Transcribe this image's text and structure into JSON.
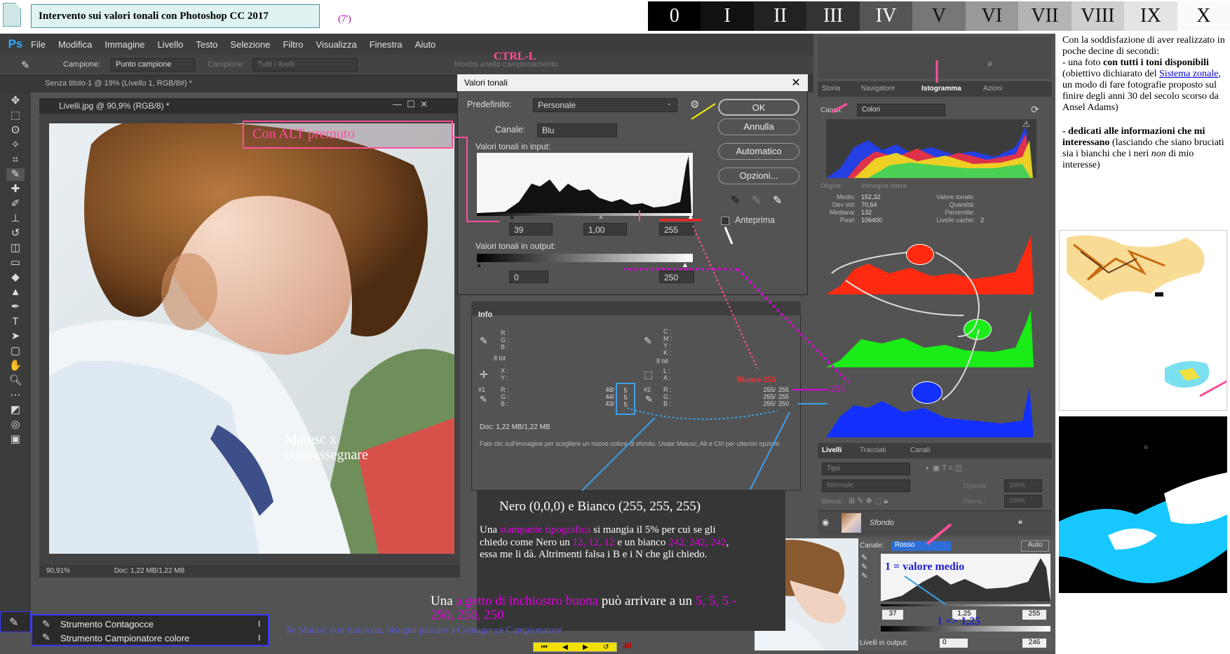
{
  "slide": {
    "title": "Intervento sui valori tonali con Photoshop CC 2017",
    "time": "(7')",
    "roman_nav": [
      "0",
      "I",
      "II",
      "III",
      "IV",
      "V",
      "VI",
      "VII",
      "VIII",
      "IX",
      "X"
    ],
    "page_number": "40"
  },
  "ps": {
    "logo": "Ps",
    "menu": [
      "File",
      "Modifica",
      "Immagine",
      "Livello",
      "Testo",
      "Selezione",
      "Filtro",
      "Visualizza",
      "Finestra",
      "Aiuto"
    ],
    "options": {
      "sample_label": "Campione:",
      "sample_value": "Punto campione",
      "size_label": "Campione:",
      "size_value": "Tutti i livelli",
      "ring_label": "Mostra anello campionamento"
    },
    "tab_bg": "Senza titolo-1 @ 19% (Livello 1, RGB/8#) *",
    "doc_title": "Livelli.jpg @ 90,9% (RGB/8) *",
    "doc_status_zoom": "90,91%",
    "doc_status_size": "Doc: 1,22 MB/1,22 MB",
    "tool_popup": [
      "Strumento Contagocce",
      "Strumento Campionatore colore"
    ],
    "tool_popup_keys": [
      "I",
      "I"
    ]
  },
  "levels": {
    "window_title": "Valori tonali",
    "preset_label": "Predefinito:",
    "preset_value": "Personale",
    "channel_label": "Canale:",
    "channel_value": "Blu",
    "input_label": "Valori tonali in input:",
    "input_values": [
      "39",
      "1,00",
      "255"
    ],
    "output_label": "Valori tonali in output:",
    "output_values": [
      "0",
      "250"
    ],
    "buttons": [
      "OK",
      "Annulla",
      "Automatico",
      "Opzioni..."
    ],
    "preview_label": "Anteprima"
  },
  "info": {
    "tab": "Info",
    "rgb_letters": [
      "R :",
      "G :",
      "B :"
    ],
    "cmyk_letters": [
      "C :",
      "M :",
      "Y :",
      "K :"
    ],
    "bit_left": "8 bit",
    "bit_right": "8 bit",
    "xy": [
      "X :",
      "Y :"
    ],
    "lab": [
      "L :",
      "A :"
    ],
    "s1_label": "#1",
    "s1_vals": [
      "48/",
      "44/",
      "43/"
    ],
    "s1_after": [
      "5",
      "5",
      "5"
    ],
    "s2_label": "#2",
    "s2_vals": [
      "255/",
      "255/",
      "255/"
    ],
    "s2_after": [
      "255",
      "255",
      "250"
    ],
    "doc": "Doc: 1,22 MB/1,22 MB",
    "hint": "Fate clic sull'immagine per scegliere un nuovo colore di sfondo. Usate Maiusc, Alt e Ctrl per ulteriori opzioni."
  },
  "dock": {
    "hist_tabs": [
      "Storia",
      "Navigatore",
      "Istogramma",
      "Azioni"
    ],
    "canali_label": "Canali:",
    "canali_value": "Colori",
    "stats_left_labels": [
      "Medio:",
      "Dev std:",
      "Mediana:",
      "Pixel:"
    ],
    "stats_left_values": [
      "152,32",
      "70,64",
      "132",
      "106400"
    ],
    "stats_right_labels": [
      "Valore tonale:",
      "Quantità:",
      "Percentile:",
      "Livello cache:"
    ],
    "stats_right_values": [
      "",
      "",
      "",
      "2"
    ],
    "origin_label": "Origine:",
    "origin_value": "Immagine intera",
    "layers_tabs": [
      "Livelli",
      "Tracciati",
      "Canali"
    ],
    "filter_placeholder": "Tipo",
    "blend_mode": "Normale",
    "opacity_label": "Opacità:",
    "opacity_value": "100%",
    "lock_label": "Blocca:",
    "fill_label": "Riemp.:",
    "fill_value": "100%",
    "layer_name": "Sfondo"
  },
  "inset": {
    "channel_label": "Canale:",
    "channel_value": "Rosso",
    "auto": "Auto",
    "input_values": [
      "37",
      "1,25",
      "255"
    ],
    "output_label": "Livelli in output:",
    "output_values": [
      "0",
      "246"
    ]
  },
  "annotations": {
    "ctrl_l": "CTRL-L",
    "alt": "Con ALT premuto",
    "maiusc": "Maiusc x contrassegnare",
    "bianco": "Bianco 255",
    "arrow255": "255",
    "nero_bianco": "Nero (0,0,0) e Bianco (255, 255, 255)",
    "stampante_pre": "Una ",
    "stampante_hl": "stampante tipografica",
    "stampante_mid": " si mangia il 5% per cui se gli chiedo come Nero un ",
    "stampante_n": "12, 12, 12",
    "stampante_mid2": " e un bianco ",
    "stampante_b": "242, 242, 242",
    "stampante_end": ", essa me  li dà. Altrimenti falsa i B e i N che gli chiedo.",
    "getto_pre": "Una ",
    "getto_hl": "a getto di inchiostro buona",
    "getto_mid": " può arrivare a un ",
    "getto_vals": "5, 5, 5 - 250, 250, 250",
    "valore_medio": "1 = valore medio",
    "freccia_125": "1 => 1,25",
    "maiusc_note": "Se Maiusc non funziona, bisogna passare a Contagocce Campionatore"
  },
  "notes": {
    "p1": "Con la soddisfazione di aver realizzato in poche decine di secondi:",
    "p2_a": "- una foto ",
    "p2_b": "con tutti i toni disponibili",
    "p2_c": " (obiettivo dichiarato del ",
    "p2_link": "Sistema zonale",
    "p2_d": ", un modo di fare fotografie proposto sul finire degli anni 30 del secolo scorso da Ansel Adams)",
    "p3_a": "- dedicati alle informazioni che mi interessano",
    "p3_b": " (lasciando che siano bruciati sia i bianchi che i neri ",
    "p3_i": "non",
    "p3_c": " di mio interesse)"
  },
  "colors": {
    "ps_bg": "#535353",
    "accent_pink": "#ff4f9a",
    "accent_magenta": "#e000e0",
    "accent_blue": "#3aa0e8"
  }
}
